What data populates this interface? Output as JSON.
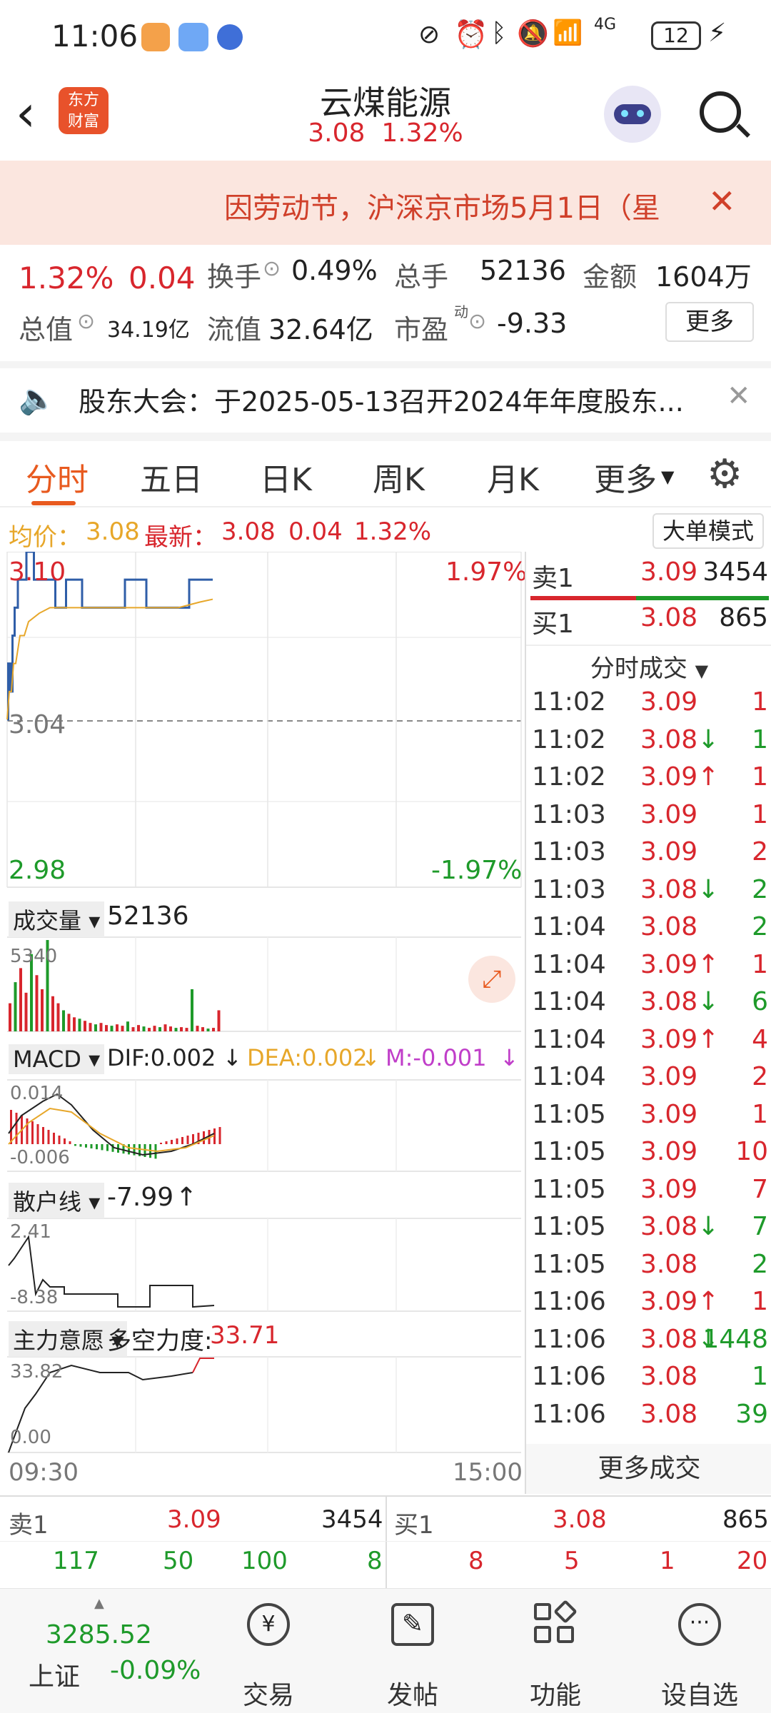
{
  "status_bar": {
    "time": "11:06",
    "battery": "12",
    "network": "4G"
  },
  "header": {
    "title": "云煤能源",
    "price": "3.08",
    "change_pct": "1.32%",
    "logo_line1": "东方",
    "logo_line2": "财富"
  },
  "notice": {
    "text": "因劳动节，沪深京市场5月1日（星"
  },
  "quote": {
    "change_pct": "1.32%",
    "change": "0.04",
    "turnover_label": "换手",
    "turnover": "0.49%",
    "volume_label": "总手",
    "volume": "52136",
    "amount_label": "金额",
    "amount": "1604万",
    "mktcap_label": "总值",
    "mktcap": "34.19亿",
    "float_label": "流值",
    "float_cap": "32.64亿",
    "pe_label": "市盈",
    "pe_sup": "动",
    "pe": "-9.33",
    "more": "更多"
  },
  "meeting": {
    "text": "股东大会：于2025-05-13召开2024年年度股东..."
  },
  "tabs": [
    "分时",
    "五日",
    "日K",
    "周K",
    "月K",
    "更多"
  ],
  "avg_bar": {
    "avg_label": "均价：",
    "avg": "3.08",
    "latest_label": "最新：",
    "latest": "3.08",
    "chg": "0.04",
    "pct": "1.32%",
    "mode_btn": "大单模式"
  },
  "chart": {
    "ymax": "3.10",
    "ymid": "3.04",
    "ymin": "2.98",
    "pmax": "1.97%",
    "pmin": "-1.97%",
    "time_start": "09:30",
    "time_end": "15:00",
    "vol_label": "成交量",
    "vol_value": "52136",
    "vol_max": "5340",
    "macd_label": "MACD",
    "dif": "DIF:0.002",
    "dea": "DEA:0.002",
    "m": "M:-0.001",
    "macd_max": "0.014",
    "macd_min": "-0.006",
    "retail_label": "散户线",
    "retail_val": "-7.99",
    "retail_max": "2.41",
    "retail_min": "-8.38",
    "main_label": "主力意愿",
    "power_label": "多空力度:",
    "power_val": "33.71",
    "main_max": "33.82",
    "main_min": "0.00"
  },
  "chart_data": {
    "type": "line",
    "x": [
      "09:30",
      "09:31",
      "09:32",
      "09:33",
      "09:34",
      "09:36",
      "09:38",
      "09:40",
      "09:45",
      "09:50",
      "09:55",
      "10:00",
      "10:10",
      "10:20",
      "10:30",
      "10:40",
      "10:50",
      "11:00",
      "11:06"
    ],
    "series": [
      {
        "values": [
          3.04,
          3.06,
          3.05,
          3.07,
          3.08,
          3.09,
          3.09,
          3.1,
          3.09,
          3.09,
          3.08,
          3.09,
          3.08,
          3.08,
          3.09,
          3.08,
          3.08,
          3.09,
          3.09
        ]
      },
      {
        "values": [
          3.04,
          3.05,
          3.05,
          3.06,
          3.06,
          3.07,
          3.07,
          3.075,
          3.078,
          3.08,
          3.08,
          3.08,
          3.08,
          3.08,
          3.08,
          3.08,
          3.08,
          3.082,
          3.083
        ]
      }
    ],
    "ylim": [
      2.98,
      3.1
    ]
  },
  "order_book": {
    "sell1_label": "卖1",
    "sell1_price": "3.09",
    "sell1_vol": "3454",
    "buy1_label": "买1",
    "buy1_price": "3.08",
    "buy1_vol": "865"
  },
  "trades_header": "分时成交",
  "trades": [
    {
      "t": "11:02",
      "p": "3.09",
      "a": "",
      "v": "1",
      "c": "red"
    },
    {
      "t": "11:02",
      "p": "3.08",
      "a": "↓",
      "v": "1",
      "c": "green"
    },
    {
      "t": "11:02",
      "p": "3.09",
      "a": "↑",
      "v": "1",
      "c": "red"
    },
    {
      "t": "11:03",
      "p": "3.09",
      "a": "",
      "v": "1",
      "c": "red"
    },
    {
      "t": "11:03",
      "p": "3.09",
      "a": "",
      "v": "2",
      "c": "red"
    },
    {
      "t": "11:03",
      "p": "3.08",
      "a": "↓",
      "v": "2",
      "c": "green"
    },
    {
      "t": "11:04",
      "p": "3.08",
      "a": "",
      "v": "2",
      "c": "green"
    },
    {
      "t": "11:04",
      "p": "3.09",
      "a": "↑",
      "v": "1",
      "c": "red"
    },
    {
      "t": "11:04",
      "p": "3.08",
      "a": "↓",
      "v": "6",
      "c": "green"
    },
    {
      "t": "11:04",
      "p": "3.09",
      "a": "↑",
      "v": "4",
      "c": "red"
    },
    {
      "t": "11:04",
      "p": "3.09",
      "a": "",
      "v": "2",
      "c": "red"
    },
    {
      "t": "11:05",
      "p": "3.09",
      "a": "",
      "v": "1",
      "c": "red"
    },
    {
      "t": "11:05",
      "p": "3.09",
      "a": "",
      "v": "10",
      "c": "red"
    },
    {
      "t": "11:05",
      "p": "3.09",
      "a": "",
      "v": "7",
      "c": "red"
    },
    {
      "t": "11:05",
      "p": "3.08",
      "a": "↓",
      "v": "7",
      "c": "green"
    },
    {
      "t": "11:05",
      "p": "3.08",
      "a": "",
      "v": "2",
      "c": "green"
    },
    {
      "t": "11:06",
      "p": "3.09",
      "a": "↑",
      "v": "1",
      "c": "red"
    },
    {
      "t": "11:06",
      "p": "3.08",
      "a": "↓",
      "v": "1448",
      "c": "green"
    },
    {
      "t": "11:06",
      "p": "3.08",
      "a": "",
      "v": "1",
      "c": "green"
    },
    {
      "t": "11:06",
      "p": "3.08",
      "a": "",
      "v": "39",
      "c": "green"
    }
  ],
  "more_trades": "更多成交",
  "level1": {
    "sell_label": "卖1",
    "sell_price": "3.09",
    "sell_vol": "3454",
    "buy_label": "买1",
    "buy_price": "3.08",
    "buy_vol": "865",
    "sell_sub": [
      "117",
      "50",
      "100",
      "8"
    ],
    "buy_sub": [
      "8",
      "5",
      "1",
      "20"
    ]
  },
  "bottom_nav": {
    "index_value": "3285.52",
    "index_name": "上证",
    "index_chg": "-0.09%",
    "items": [
      "交易",
      "发帖",
      "功能",
      "设自选"
    ]
  }
}
